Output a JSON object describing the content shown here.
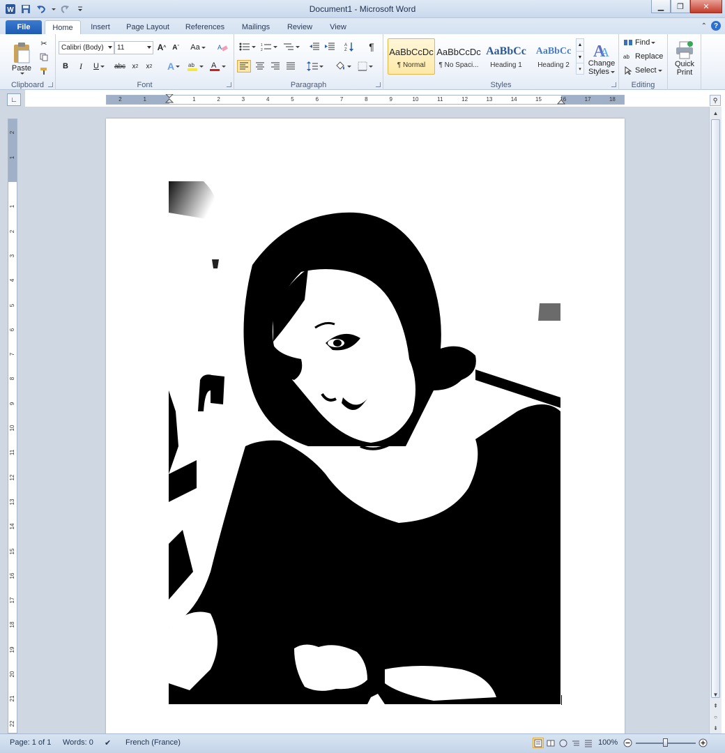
{
  "window": {
    "title": "Document1  -  Microsoft Word"
  },
  "tabs": [
    "File",
    "Home",
    "Insert",
    "Page Layout",
    "References",
    "Mailings",
    "Review",
    "View"
  ],
  "active_tab": "Home",
  "clipboard": {
    "paste_label": "Paste",
    "group_label": "Clipboard"
  },
  "font": {
    "family_value": "Calibri (Body)",
    "size_value": "11",
    "group_label": "Font"
  },
  "paragraph": {
    "group_label": "Paragraph"
  },
  "styles": {
    "group_label": "Styles",
    "items": [
      {
        "preview": "AaBbCcDc",
        "name": "¶ Normal"
      },
      {
        "preview": "AaBbCcDc",
        "name": "¶ No Spaci..."
      },
      {
        "preview": "AaBbCc",
        "name": "Heading 1"
      },
      {
        "preview": "AaBbCc",
        "name": "Heading 2"
      }
    ],
    "change_styles_line1": "Change",
    "change_styles_line2": "Styles"
  },
  "editing": {
    "find": "Find",
    "replace": "Replace",
    "select": "Select",
    "group_label": "Editing"
  },
  "quick_print": {
    "line1": "Quick",
    "line2": "Print"
  },
  "ruler": {
    "h_ticks": [
      "2",
      "1",
      "1",
      "2",
      "3",
      "4",
      "5",
      "6",
      "7",
      "8",
      "9",
      "10",
      "11",
      "12",
      "13",
      "14",
      "15",
      "16",
      "17",
      "18"
    ],
    "v_ticks": [
      "2",
      "1",
      "1",
      "2",
      "3",
      "4",
      "5",
      "6",
      "7",
      "8",
      "9",
      "10",
      "11",
      "12",
      "13",
      "14",
      "15",
      "16",
      "17",
      "18",
      "19",
      "20",
      "21",
      "22"
    ]
  },
  "status": {
    "page": "Page: 1 of 1",
    "words": "Words: 0",
    "language": "French (France)",
    "zoom": "100%"
  },
  "colors": {
    "highlight": "#f3e93c",
    "font_color": "#d11f1f",
    "accent": "#2b579a"
  }
}
